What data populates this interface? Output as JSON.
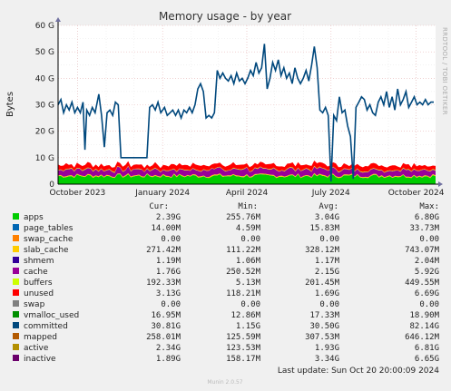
{
  "chart_data": {
    "type": "area",
    "title": "Memory usage - by year",
    "ylabel": "Bytes",
    "side_label": "RRDTOOL / TOBI OETIKER",
    "ylim": [
      0,
      60
    ],
    "yticks": [
      "0",
      "10 G",
      "20 G",
      "30 G",
      "40 G",
      "50 G",
      "60 G"
    ],
    "xticks": [
      "October 2023",
      "January 2024",
      "April 2024",
      "July 2024",
      "October 2024"
    ],
    "xrange": [
      "2023-09-10",
      "2024-10-22"
    ],
    "xtick_dates": [
      "2023-10-01",
      "2024-01-01",
      "2024-04-01",
      "2024-07-01",
      "2024-10-01"
    ],
    "grid": true,
    "columns": [
      "Cur:",
      "Min:",
      "Avg:",
      "Max:"
    ],
    "series": [
      {
        "name": "apps",
        "color": "#00cc00",
        "cur": "2.39G",
        "min": "255.76M",
        "avg": "3.04G",
        "max": "6.80G"
      },
      {
        "name": "page_tables",
        "color": "#0066b3",
        "cur": "14.00M",
        "min": "4.59M",
        "avg": "15.83M",
        "max": "33.73M"
      },
      {
        "name": "swap_cache",
        "color": "#ff8000",
        "cur": "0.00",
        "min": "0.00",
        "avg": "0.00",
        "max": "0.00"
      },
      {
        "name": "slab_cache",
        "color": "#ffcc00",
        "cur": "271.42M",
        "min": "111.22M",
        "avg": "328.12M",
        "max": "743.07M"
      },
      {
        "name": "shmem",
        "color": "#330099",
        "cur": "1.19M",
        "min": "1.06M",
        "avg": "1.17M",
        "max": "2.04M"
      },
      {
        "name": "cache",
        "color": "#990099",
        "cur": "1.76G",
        "min": "250.52M",
        "avg": "2.15G",
        "max": "5.92G"
      },
      {
        "name": "buffers",
        "color": "#ccff00",
        "cur": "192.33M",
        "min": "5.13M",
        "avg": "201.45M",
        "max": "449.55M"
      },
      {
        "name": "unused",
        "color": "#ff0000",
        "cur": "3.13G",
        "min": "118.21M",
        "avg": "1.69G",
        "max": "6.69G"
      },
      {
        "name": "swap",
        "color": "#808080",
        "cur": "0.00",
        "min": "0.00",
        "avg": "0.00",
        "max": "0.00"
      },
      {
        "name": "vmalloc_used",
        "color": "#008f00",
        "cur": "16.95M",
        "min": "12.86M",
        "avg": "17.33M",
        "max": "18.90M"
      },
      {
        "name": "committed",
        "color": "#00487d",
        "cur": "30.81G",
        "min": "1.15G",
        "avg": "30.50G",
        "max": "82.14G"
      },
      {
        "name": "mapped",
        "color": "#b35a00",
        "cur": "258.01M",
        "min": "125.59M",
        "avg": "307.53M",
        "max": "646.12M"
      },
      {
        "name": "active",
        "color": "#b38f00",
        "cur": "2.34G",
        "min": "123.53M",
        "avg": "1.93G",
        "max": "6.81G"
      },
      {
        "name": "inactive",
        "color": "#6b006b",
        "cur": "1.89G",
        "min": "158.17M",
        "avg": "3.34G",
        "max": "6.65G"
      }
    ],
    "committed_series": [
      [
        "2023-09-10",
        30
      ],
      [
        "2023-09-13",
        32
      ],
      [
        "2023-09-16",
        27
      ],
      [
        "2023-09-19",
        30
      ],
      [
        "2023-09-22",
        28
      ],
      [
        "2023-09-25",
        31
      ],
      [
        "2023-09-28",
        27
      ],
      [
        "2023-10-01",
        29
      ],
      [
        "2023-10-04",
        27
      ],
      [
        "2023-10-07",
        31
      ],
      [
        "2023-10-09",
        13
      ],
      [
        "2023-10-11",
        28
      ],
      [
        "2023-10-14",
        26
      ],
      [
        "2023-10-17",
        29
      ],
      [
        "2023-10-20",
        27
      ],
      [
        "2023-10-24",
        34
      ],
      [
        "2023-10-27",
        26
      ],
      [
        "2023-10-30",
        14
      ],
      [
        "2023-11-02",
        27
      ],
      [
        "2023-11-05",
        28
      ],
      [
        "2023-11-08",
        26
      ],
      [
        "2023-11-11",
        31
      ],
      [
        "2023-11-14",
        30
      ],
      [
        "2023-11-17",
        10
      ],
      [
        "2023-12-01",
        10
      ],
      [
        "2023-12-15",
        10
      ],
      [
        "2023-12-18",
        29
      ],
      [
        "2023-12-21",
        30
      ],
      [
        "2023-12-24",
        28
      ],
      [
        "2023-12-27",
        31
      ],
      [
        "2023-12-30",
        27
      ],
      [
        "2024-01-03",
        29
      ],
      [
        "2024-01-06",
        26
      ],
      [
        "2024-01-09",
        27
      ],
      [
        "2024-01-12",
        28
      ],
      [
        "2024-01-15",
        26
      ],
      [
        "2024-01-18",
        28
      ],
      [
        "2024-01-21",
        25
      ],
      [
        "2024-01-24",
        28
      ],
      [
        "2024-01-27",
        27
      ],
      [
        "2024-01-30",
        29
      ],
      [
        "2024-02-02",
        27
      ],
      [
        "2024-02-05",
        30
      ],
      [
        "2024-02-08",
        36
      ],
      [
        "2024-02-11",
        38
      ],
      [
        "2024-02-14",
        35
      ],
      [
        "2024-02-17",
        25
      ],
      [
        "2024-02-20",
        26
      ],
      [
        "2024-02-23",
        25
      ],
      [
        "2024-02-26",
        27
      ],
      [
        "2024-02-29",
        43
      ],
      [
        "2024-03-03",
        40
      ],
      [
        "2024-03-06",
        42
      ],
      [
        "2024-03-09",
        40
      ],
      [
        "2024-03-12",
        39
      ],
      [
        "2024-03-15",
        41
      ],
      [
        "2024-03-18",
        38
      ],
      [
        "2024-03-21",
        42
      ],
      [
        "2024-03-24",
        39
      ],
      [
        "2024-03-27",
        40
      ],
      [
        "2024-03-30",
        38
      ],
      [
        "2024-04-02",
        40
      ],
      [
        "2024-04-05",
        43
      ],
      [
        "2024-04-08",
        41
      ],
      [
        "2024-04-11",
        46
      ],
      [
        "2024-04-14",
        42
      ],
      [
        "2024-04-17",
        44
      ],
      [
        "2024-04-20",
        53
      ],
      [
        "2024-04-23",
        36
      ],
      [
        "2024-04-26",
        40
      ],
      [
        "2024-04-29",
        46
      ],
      [
        "2024-05-02",
        43
      ],
      [
        "2024-05-05",
        47
      ],
      [
        "2024-05-08",
        41
      ],
      [
        "2024-05-11",
        44
      ],
      [
        "2024-05-14",
        40
      ],
      [
        "2024-05-17",
        42
      ],
      [
        "2024-05-20",
        38
      ],
      [
        "2024-05-23",
        44
      ],
      [
        "2024-05-26",
        40
      ],
      [
        "2024-05-29",
        38
      ],
      [
        "2024-06-01",
        40
      ],
      [
        "2024-06-04",
        43
      ],
      [
        "2024-06-07",
        39
      ],
      [
        "2024-06-10",
        45
      ],
      [
        "2024-06-13",
        52
      ],
      [
        "2024-06-16",
        44
      ],
      [
        "2024-06-19",
        28
      ],
      [
        "2024-06-22",
        27
      ],
      [
        "2024-06-25",
        29
      ],
      [
        "2024-06-28",
        26
      ],
      [
        "2024-07-01",
        1
      ],
      [
        "2024-07-04",
        26
      ],
      [
        "2024-07-07",
        24
      ],
      [
        "2024-07-10",
        33
      ],
      [
        "2024-07-13",
        27
      ],
      [
        "2024-07-16",
        28
      ],
      [
        "2024-07-19",
        22
      ],
      [
        "2024-07-22",
        18
      ],
      [
        "2024-07-25",
        2
      ],
      [
        "2024-07-28",
        29
      ],
      [
        "2024-07-31",
        31
      ],
      [
        "2024-08-03",
        33
      ],
      [
        "2024-08-06",
        32
      ],
      [
        "2024-08-09",
        28
      ],
      [
        "2024-08-12",
        30
      ],
      [
        "2024-08-15",
        27
      ],
      [
        "2024-08-18",
        26
      ],
      [
        "2024-08-21",
        31
      ],
      [
        "2024-08-24",
        33
      ],
      [
        "2024-08-27",
        30
      ],
      [
        "2024-08-30",
        35
      ],
      [
        "2024-09-02",
        29
      ],
      [
        "2024-09-05",
        33
      ],
      [
        "2024-09-08",
        28
      ],
      [
        "2024-09-11",
        36
      ],
      [
        "2024-09-14",
        30
      ],
      [
        "2024-09-17",
        32
      ],
      [
        "2024-09-20",
        35
      ],
      [
        "2024-09-23",
        29
      ],
      [
        "2024-09-26",
        31
      ],
      [
        "2024-09-29",
        33
      ],
      [
        "2024-10-02",
        30
      ],
      [
        "2024-10-05",
        31
      ],
      [
        "2024-10-08",
        30
      ],
      [
        "2024-10-11",
        32
      ],
      [
        "2024-10-14",
        30
      ],
      [
        "2024-10-17",
        31
      ],
      [
        "2024-10-20",
        31
      ]
    ],
    "last_update": "Last update: Sun Oct 20 20:00:09 2024",
    "footer_mark": "Munin 2.0.57"
  }
}
